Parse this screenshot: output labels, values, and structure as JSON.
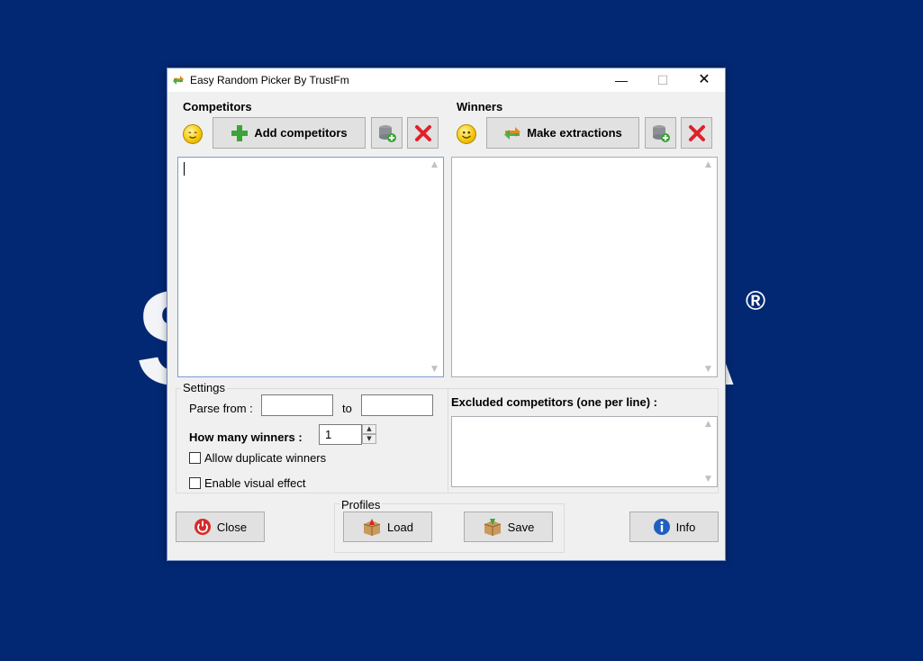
{
  "window": {
    "title": "Easy Random Picker By TrustFm",
    "min_glyph": "—",
    "max_glyph": "☐",
    "close_glyph": "✕"
  },
  "competitors": {
    "label": "Competitors",
    "add_button": "Add competitors",
    "text": ""
  },
  "winners": {
    "label": "Winners",
    "extract_button": "Make extractions",
    "text": ""
  },
  "settings": {
    "title": "Settings",
    "parse_from_label": "Parse from :",
    "parse_from_value": "",
    "to_label": "to",
    "to_value": "",
    "how_many_label": "How many winners :",
    "how_many_value": "1",
    "allow_duplicate_label": "Allow duplicate winners",
    "allow_duplicate_checked": false,
    "visual_effect_label": "Enable visual effect",
    "visual_effect_checked": false
  },
  "excluded": {
    "label": "Excluded competitors (one per line) :",
    "text": ""
  },
  "footer": {
    "close_button": "Close",
    "profiles_title": "Profiles",
    "load_button": "Load",
    "save_button": "Save",
    "info_button": "Info"
  },
  "colors": {
    "desktop": "#032873",
    "window_bg": "#f0f0f0",
    "button_bg": "#e1e1e1",
    "delete_red": "#e0202a",
    "add_green": "#3aa537"
  }
}
